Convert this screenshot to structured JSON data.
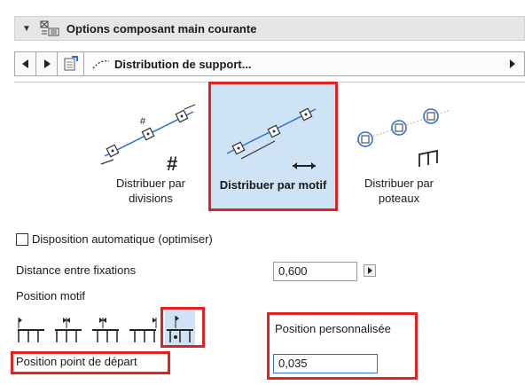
{
  "header": {
    "title": "Options composant main courante",
    "collapse_icon": "triangle-down-icon",
    "icon": "railing-component-icon"
  },
  "toolbar": {
    "prev_icon": "triangle-left-icon",
    "next_icon": "triangle-right-icon",
    "settings_icon": "document-settings-icon",
    "dropdown_label": "Distribution de support...",
    "dropdown_icon": "dotted-curve-icon",
    "dropdown_caret": "triangle-right-icon"
  },
  "distribution": {
    "options": [
      {
        "label_line1": "Distribuer par",
        "label_line2": "divisions",
        "icon": "distribute-divisions-icon",
        "selected": false
      },
      {
        "label_line1": "Distribuer par motif",
        "label_line2": "",
        "icon": "distribute-pattern-icon",
        "selected": true
      },
      {
        "label_line1": "Distribuer par",
        "label_line2": "poteaux",
        "icon": "distribute-posts-icon",
        "selected": false
      }
    ]
  },
  "auto_layout": {
    "label": "Disposition automatique (optimiser)",
    "checked": false
  },
  "spacing": {
    "label": "Distance entre fixations",
    "value": "0,600"
  },
  "motif_position": {
    "label": "Position motif",
    "options": [
      "pattern-start-icon",
      "pattern-center-left-icon",
      "pattern-center-icon",
      "pattern-end-icon",
      "pattern-custom-icon"
    ],
    "selected_index": 4
  },
  "start_point": {
    "label": "Position point de départ"
  },
  "custom_position": {
    "label": "Position personnalisée",
    "value": "0,035"
  },
  "colors": {
    "highlight": "#e52020",
    "selected_bg": "#cfe3f6",
    "accent_blue": "#2e6fcf"
  }
}
